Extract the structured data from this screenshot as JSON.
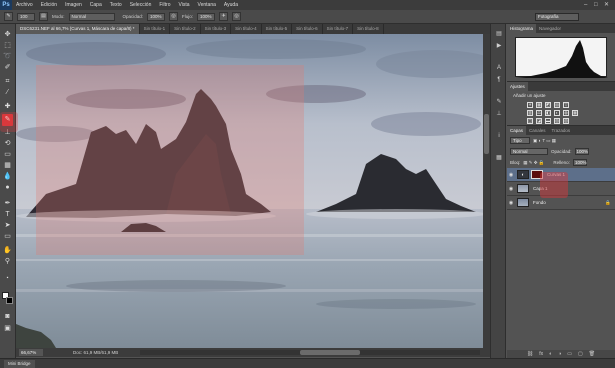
{
  "app": {
    "logo": "Ps"
  },
  "menu": [
    "Archivo",
    "Edición",
    "Imagen",
    "Capa",
    "Texto",
    "Selección",
    "Filtro",
    "Vista",
    "Ventana",
    "Ayuda"
  ],
  "window_controls": [
    "–",
    "□",
    "✕"
  ],
  "options": {
    "mode_label": "Modo:",
    "mode_value": "Normal",
    "opacity_label": "Opacidad:",
    "opacity_value": "100%",
    "flow_label": "Flujo:",
    "flow_value": "100%",
    "brush_size": "100"
  },
  "workspace": "Fotografía",
  "tabs": [
    {
      "label": "DSC6231.NEF al 66,7% (Curvas 1, Máscara de capa/8) *",
      "active": true
    },
    {
      "label": "Sin título-1",
      "active": false
    },
    {
      "label": "Sin título-2",
      "active": false
    },
    {
      "label": "Sin título-3",
      "active": false
    },
    {
      "label": "Sin título-4",
      "active": false
    },
    {
      "label": "Sin título-5",
      "active": false
    },
    {
      "label": "Sin título-6",
      "active": false
    },
    {
      "label": "Sin título-7",
      "active": false
    },
    {
      "label": "Sin título-8",
      "active": false
    }
  ],
  "status": {
    "zoom": "66,67%",
    "doc_info": "Doc: 61,9 MB/61,9 MB"
  },
  "bottom_tab": "Mini Bridge",
  "histogram_panel": {
    "tabs": [
      "Histograma",
      "Navegador"
    ]
  },
  "adjustments_panel": {
    "tab": "Ajustes",
    "title": "Añadir un ajuste",
    "row1": [
      "☀",
      "▦",
      "◩",
      "▤",
      "▽"
    ],
    "row2": [
      "▥",
      "⚖",
      "◧",
      "◐",
      "◍",
      "▦"
    ],
    "row3": [
      "◫",
      "◪",
      "▬",
      "▨",
      "▧"
    ]
  },
  "layers_panel": {
    "tabs": [
      "Capas",
      "Canales",
      "Trazados"
    ],
    "filter": "Tipo",
    "blend_mode": "Normal",
    "opacity_label": "Opacidad:",
    "opacity_value": "100%",
    "lock_label": "Bloq:",
    "fill_label": "Relleno:",
    "fill_value": "100%",
    "layers": [
      {
        "name": "Curvas 1",
        "selected": true
      },
      {
        "name": "Capa 1",
        "selected": false
      },
      {
        "name": "Fondo",
        "selected": false
      }
    ],
    "footer_icons": [
      "⛓",
      "fx",
      "◐",
      "◑",
      "▭",
      "▢",
      "🗑"
    ]
  },
  "toolbar": {
    "tools": [
      "move-tool",
      "marquee-tool",
      "lasso-tool",
      "quick-select-tool",
      "crop-tool",
      "eyedropper-tool",
      "healing-tool",
      "brush-tool",
      "clone-stamp-tool",
      "history-brush-tool",
      "eraser-tool",
      "gradient-tool",
      "blur-tool",
      "dodge-tool",
      "pen-tool",
      "type-tool",
      "path-select-tool",
      "shape-tool",
      "hand-tool",
      "zoom-tool"
    ],
    "active_tool": "brush-tool"
  }
}
